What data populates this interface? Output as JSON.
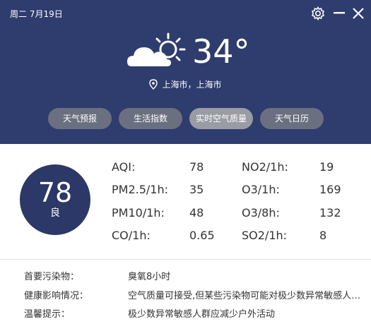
{
  "header": {
    "date": "周二 7月19日",
    "temperature": "34°",
    "location": "上海市，上海市",
    "weather_icon": "partly-cloudy-icon"
  },
  "tabs": [
    {
      "label": "天气预报",
      "active": false
    },
    {
      "label": "生活指数",
      "active": false
    },
    {
      "label": "实时空气质量",
      "active": true
    },
    {
      "label": "天气日历",
      "active": false
    }
  ],
  "aqi": {
    "value": "78",
    "level": "良"
  },
  "metrics": {
    "aqi_label": "AQI:",
    "aqi_value": "78",
    "pm25_label": "PM2.5/1h:",
    "pm25_value": "35",
    "pm10_label": "PM10/1h:",
    "pm10_value": "48",
    "co_label": "CO/1h:",
    "co_value": "0.65",
    "no2_label": "NO2/1h:",
    "no2_value": "19",
    "o3_1h_label": "O3/1h:",
    "o3_1h_value": "169",
    "o3_8h_label": "O3/8h:",
    "o3_8h_value": "132",
    "so2_label": "SO2/1h:",
    "so2_value": "8"
  },
  "info": {
    "pollutant_label": "首要污染物：",
    "pollutant_value": "臭氧8小时",
    "health_label": "健康影响情况：",
    "health_value": "空气质量可接受,但某些污染物可能对极少数异常敏感人群健康有较弱影响",
    "tip_label": "温馨提示：",
    "tip_value": "极少数异常敏感人群应减少户外活动"
  },
  "colors": {
    "header_bg": "#2e3c6e",
    "circle_bg": "#2b3868",
    "tab_bg": "#6b7080",
    "tab_active_bg": "#9a9ca4"
  }
}
